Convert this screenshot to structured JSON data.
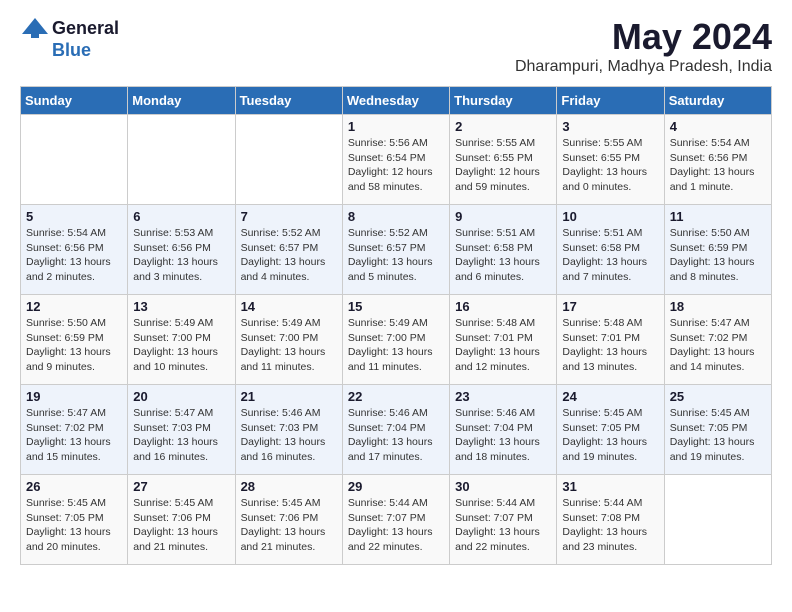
{
  "logo": {
    "general": "General",
    "blue": "Blue"
  },
  "title": "May 2024",
  "location": "Dharampuri, Madhya Pradesh, India",
  "headers": [
    "Sunday",
    "Monday",
    "Tuesday",
    "Wednesday",
    "Thursday",
    "Friday",
    "Saturday"
  ],
  "weeks": [
    [
      {
        "day": "",
        "info": ""
      },
      {
        "day": "",
        "info": ""
      },
      {
        "day": "",
        "info": ""
      },
      {
        "day": "1",
        "info": "Sunrise: 5:56 AM\nSunset: 6:54 PM\nDaylight: 12 hours\nand 58 minutes."
      },
      {
        "day": "2",
        "info": "Sunrise: 5:55 AM\nSunset: 6:55 PM\nDaylight: 12 hours\nand 59 minutes."
      },
      {
        "day": "3",
        "info": "Sunrise: 5:55 AM\nSunset: 6:55 PM\nDaylight: 13 hours\nand 0 minutes."
      },
      {
        "day": "4",
        "info": "Sunrise: 5:54 AM\nSunset: 6:56 PM\nDaylight: 13 hours\nand 1 minute."
      }
    ],
    [
      {
        "day": "5",
        "info": "Sunrise: 5:54 AM\nSunset: 6:56 PM\nDaylight: 13 hours\nand 2 minutes."
      },
      {
        "day": "6",
        "info": "Sunrise: 5:53 AM\nSunset: 6:56 PM\nDaylight: 13 hours\nand 3 minutes."
      },
      {
        "day": "7",
        "info": "Sunrise: 5:52 AM\nSunset: 6:57 PM\nDaylight: 13 hours\nand 4 minutes."
      },
      {
        "day": "8",
        "info": "Sunrise: 5:52 AM\nSunset: 6:57 PM\nDaylight: 13 hours\nand 5 minutes."
      },
      {
        "day": "9",
        "info": "Sunrise: 5:51 AM\nSunset: 6:58 PM\nDaylight: 13 hours\nand 6 minutes."
      },
      {
        "day": "10",
        "info": "Sunrise: 5:51 AM\nSunset: 6:58 PM\nDaylight: 13 hours\nand 7 minutes."
      },
      {
        "day": "11",
        "info": "Sunrise: 5:50 AM\nSunset: 6:59 PM\nDaylight: 13 hours\nand 8 minutes."
      }
    ],
    [
      {
        "day": "12",
        "info": "Sunrise: 5:50 AM\nSunset: 6:59 PM\nDaylight: 13 hours\nand 9 minutes."
      },
      {
        "day": "13",
        "info": "Sunrise: 5:49 AM\nSunset: 7:00 PM\nDaylight: 13 hours\nand 10 minutes."
      },
      {
        "day": "14",
        "info": "Sunrise: 5:49 AM\nSunset: 7:00 PM\nDaylight: 13 hours\nand 11 minutes."
      },
      {
        "day": "15",
        "info": "Sunrise: 5:49 AM\nSunset: 7:00 PM\nDaylight: 13 hours\nand 11 minutes."
      },
      {
        "day": "16",
        "info": "Sunrise: 5:48 AM\nSunset: 7:01 PM\nDaylight: 13 hours\nand 12 minutes."
      },
      {
        "day": "17",
        "info": "Sunrise: 5:48 AM\nSunset: 7:01 PM\nDaylight: 13 hours\nand 13 minutes."
      },
      {
        "day": "18",
        "info": "Sunrise: 5:47 AM\nSunset: 7:02 PM\nDaylight: 13 hours\nand 14 minutes."
      }
    ],
    [
      {
        "day": "19",
        "info": "Sunrise: 5:47 AM\nSunset: 7:02 PM\nDaylight: 13 hours\nand 15 minutes."
      },
      {
        "day": "20",
        "info": "Sunrise: 5:47 AM\nSunset: 7:03 PM\nDaylight: 13 hours\nand 16 minutes."
      },
      {
        "day": "21",
        "info": "Sunrise: 5:46 AM\nSunset: 7:03 PM\nDaylight: 13 hours\nand 16 minutes."
      },
      {
        "day": "22",
        "info": "Sunrise: 5:46 AM\nSunset: 7:04 PM\nDaylight: 13 hours\nand 17 minutes."
      },
      {
        "day": "23",
        "info": "Sunrise: 5:46 AM\nSunset: 7:04 PM\nDaylight: 13 hours\nand 18 minutes."
      },
      {
        "day": "24",
        "info": "Sunrise: 5:45 AM\nSunset: 7:05 PM\nDaylight: 13 hours\nand 19 minutes."
      },
      {
        "day": "25",
        "info": "Sunrise: 5:45 AM\nSunset: 7:05 PM\nDaylight: 13 hours\nand 19 minutes."
      }
    ],
    [
      {
        "day": "26",
        "info": "Sunrise: 5:45 AM\nSunset: 7:05 PM\nDaylight: 13 hours\nand 20 minutes."
      },
      {
        "day": "27",
        "info": "Sunrise: 5:45 AM\nSunset: 7:06 PM\nDaylight: 13 hours\nand 21 minutes."
      },
      {
        "day": "28",
        "info": "Sunrise: 5:45 AM\nSunset: 7:06 PM\nDaylight: 13 hours\nand 21 minutes."
      },
      {
        "day": "29",
        "info": "Sunrise: 5:44 AM\nSunset: 7:07 PM\nDaylight: 13 hours\nand 22 minutes."
      },
      {
        "day": "30",
        "info": "Sunrise: 5:44 AM\nSunset: 7:07 PM\nDaylight: 13 hours\nand 22 minutes."
      },
      {
        "day": "31",
        "info": "Sunrise: 5:44 AM\nSunset: 7:08 PM\nDaylight: 13 hours\nand 23 minutes."
      },
      {
        "day": "",
        "info": ""
      }
    ]
  ]
}
